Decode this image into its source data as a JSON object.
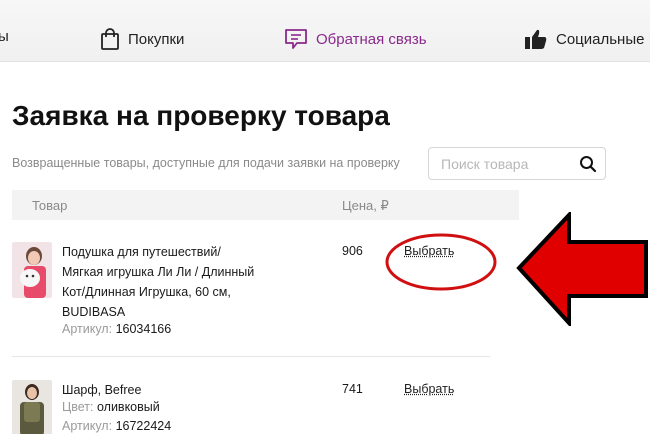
{
  "nav": {
    "cut_left": "ы",
    "purchases": "Покупки",
    "feedback": "Обратная связь",
    "social": "Социальные"
  },
  "page": {
    "title": "Заявка на проверку товара",
    "subtitle": "Возвращенные товары, доступные для подачи заявки на проверку"
  },
  "search": {
    "placeholder": "Поиск товара"
  },
  "table": {
    "col_product": "Товар",
    "col_price": "Цена, ₽"
  },
  "items": [
    {
      "name_lines": [
        "Подушка для путешествий/",
        "Мягкая игрушка Ли Ли / Длинный",
        "Кот/Длинная Игрушка, 60 см,",
        "BUDIBASA"
      ],
      "article_label": "Артикул:",
      "article": "16034166",
      "price": "906",
      "action": "Выбрать"
    },
    {
      "name_lines": [
        "Шарф, Befree"
      ],
      "color_label": "Цвет:",
      "color": "оливковый",
      "article_label": "Артикул:",
      "article": "16722424",
      "price": "741",
      "action": "Выбрать"
    }
  ],
  "annotation_colors": {
    "ellipse": "#d01010",
    "arrow": "#e00000",
    "arrow_border": "#000000"
  }
}
